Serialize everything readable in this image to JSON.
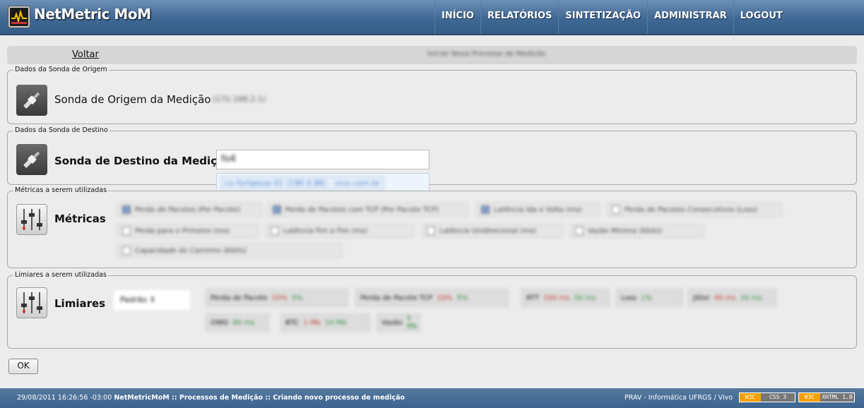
{
  "header": {
    "app_title": "NetMetric MoM",
    "nav": [
      "INÍCIO",
      "RELATÓRIOS",
      "SINTETIZAÇÃO",
      "ADMINISTRAR",
      "LOGOUT"
    ]
  },
  "breadcrumb": {
    "back_label": "Voltar",
    "path": "Iniciar Nova Processo de Medição"
  },
  "origin": {
    "legend": "Dados da Sonda de Origem",
    "label": "Sonda de Origem da Medição",
    "value": "(172.168.2.1)"
  },
  "destination": {
    "legend": "Dados da Sonda de Destino",
    "label": "Sonda de Destino da Medição",
    "input_value": "fo4",
    "suggestion": "co-fortaleza-01 (190.0.86) - vivo.com.br"
  },
  "metrics": {
    "legend": "Métricas a serem utilizadas",
    "label": "Métricas",
    "items": [
      {
        "label": "Perda de Pacotes (Por Pacote)",
        "checked": true
      },
      {
        "label": "Perda de Pacotes com TCP (Por Pacote TCP)",
        "checked": true
      },
      {
        "label": "Latência Ida e Volta (ms)",
        "checked": true
      },
      {
        "label": "Perda de Pacotes Consecutivos (Loss)",
        "checked": false
      },
      {
        "label": "Perda para o Primeiro (ms)",
        "checked": false
      },
      {
        "label": "Latência Fim a Fim (ms)",
        "checked": false
      },
      {
        "label": "Latência Unidirecional (ms)",
        "checked": false
      },
      {
        "label": "Vazão Mínima (Kbits)",
        "checked": false
      },
      {
        "label": "Capacidade do Caminho (Kbits)",
        "checked": false
      }
    ]
  },
  "thresholds": {
    "legend": "Limiares a serem utilizadas",
    "label": "Limiares",
    "select_value": "Padrão",
    "items": [
      {
        "name": "Perda de Pacote",
        "bad": "10%",
        "good": "5%"
      },
      {
        "name": "Perda de Pacote TCP",
        "bad": "10%",
        "good": "5%"
      },
      {
        "name": "RTT",
        "bad": "100 ms",
        "good": "50 ms"
      },
      {
        "name": "Loss",
        "bad": "",
        "good": "1%"
      },
      {
        "name": "Jitter",
        "bad": "40 ms",
        "good": "20 ms"
      },
      {
        "name": "OWD",
        "bad": "",
        "good": "80 ms"
      },
      {
        "name": "BTC",
        "bad": "1 Mb",
        "good": "10 Mb"
      },
      {
        "name": "Vazão",
        "bad": "",
        "good": "5 Mb"
      }
    ]
  },
  "ok_label": "OK",
  "footer": {
    "timestamp": "29/08/2011 16:26:56 -03:00",
    "breadcrumb": "NetMetricMoM :: Processos de Medição :: Criando novo processo de medição",
    "credits": "PRAV - Informática UFRGS / Vivo",
    "badge_css": "CSS 3",
    "badge_xhtml": "XHTML 1.0",
    "badge_w3c": "W3C"
  },
  "colors": {
    "header": "#3f6894",
    "footer": "#3c6490",
    "content_bg": "#ececec",
    "threshold_bad": "#c0392b",
    "threshold_good": "#2e8b3a",
    "checkbox_on": "#7f9ccd"
  }
}
